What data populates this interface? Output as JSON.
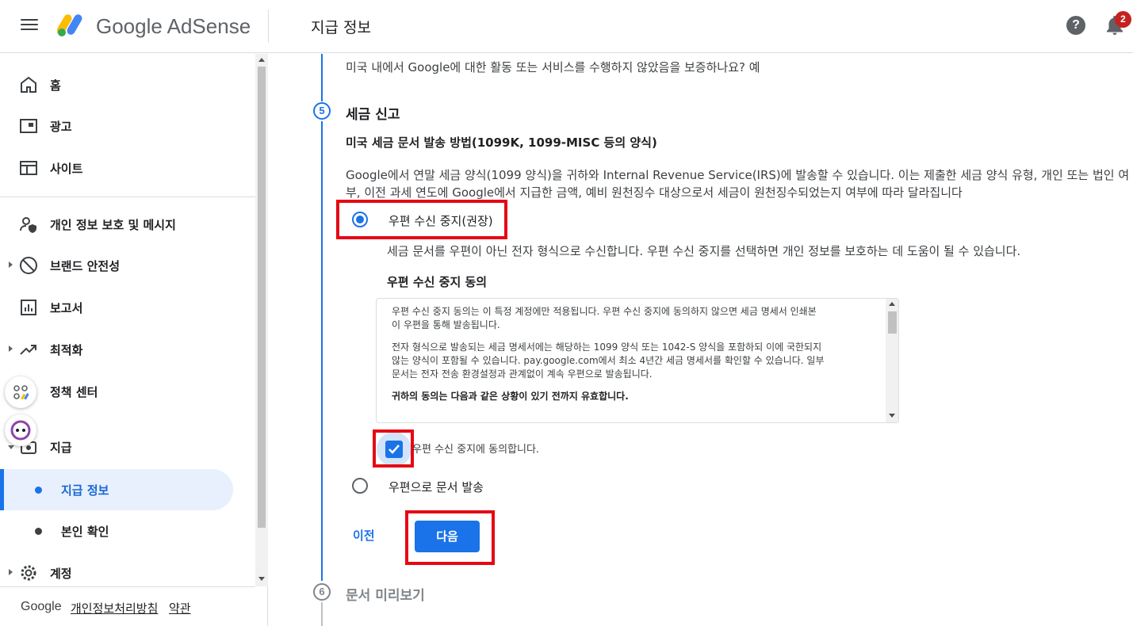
{
  "header": {
    "brand": "Google AdSense",
    "page_title": "지급 정보",
    "notification_count": "2",
    "help_symbol": "?"
  },
  "sidebar": {
    "items": [
      {
        "label": "홈",
        "icon": "home-icon"
      },
      {
        "label": "광고",
        "icon": "ads-icon"
      },
      {
        "label": "사이트",
        "icon": "sites-icon"
      },
      {
        "label": "개인 정보 보호 및 메시지",
        "icon": "privacy-icon"
      },
      {
        "label": "브랜드 안전성",
        "icon": "block-icon"
      },
      {
        "label": "보고서",
        "icon": "reports-icon"
      },
      {
        "label": "최적화",
        "icon": "optimization-icon"
      },
      {
        "label": "정책 센터",
        "icon": "policy-icon"
      },
      {
        "label": "지급",
        "icon": "payments-icon"
      }
    ],
    "sub_items": [
      {
        "label": "지급 정보",
        "active": true
      },
      {
        "label": "본인 확인",
        "active": false
      }
    ],
    "account": {
      "label": "계정",
      "icon": "gear-icon"
    },
    "footer": {
      "google": "Google",
      "privacy": "개인정보처리방침",
      "terms": "약관"
    }
  },
  "main": {
    "prev_answer": "미국 내에서 Google에 대한 활동 또는 서비스를 수행하지 않았음을 보증하나요? 예",
    "step5": {
      "number": "5",
      "title": "세금 신고"
    },
    "section_heading": "미국 세금 문서 발송 방법(1099K, 1099-MISC 등의 양식)",
    "description_line1": "Google에서 연말 세금 양식(1099 양식)을 귀하와 Internal Revenue Service(IRS)에 발송할 수 있습니다. 이는 제출한 세금 양식 유형, 개인 또는 법인 여",
    "description_line2": "부, 이전 과세 연도에 Google에서 지급한 금액, 예비 원천징수 대상으로서 세금이 원천징수되었는지 여부에 따라 달라집니다",
    "option1": {
      "label": "우편 수신 중지(권장)",
      "selected": true,
      "description": "세금 문서를 우편이 아닌 전자 형식으로 수신합니다. 우편 수신 중지를 선택하면 개인 정보를 보호하는 데 도움이 될 수 있습니다."
    },
    "agreement": {
      "heading": "우편 수신 중지 동의",
      "para1_line1": "우편 수신 중지 동의는 이 특정 계정에만 적용됩니다.  우편 수신 중지에 동의하지 않으면 세금 명세서 인쇄본",
      "para1_line2": "이 우편을 통해 발송됩니다.",
      "para2_line1": "전자 형식으로 발송되는 세금 명세서에는 해당하는 1099 양식 또는 1042-S 양식을 포함하되 이에 국한되지",
      "para2_line2": "않는 양식이 포함될 수 있습니다. pay.google.com에서 최소 4년간 세금 명세서를 확인할 수 있습니다. 일부",
      "para2_line3": "문서는 전자 전송 환경설정과 관계없이 계속 우편으로 발송됩니다.",
      "para3": "귀하의 동의는 다음과 같은 상황이 있기 전까지 유효합니다.",
      "checkbox_label": "우편 수신 중지에 동의합니다.",
      "checked": true
    },
    "option2": {
      "label": "우편으로 문서 발송",
      "selected": false
    },
    "buttons": {
      "prev": "이전",
      "next": "다음"
    },
    "step6": {
      "number": "6",
      "title": "문서 미리보기"
    }
  },
  "colors": {
    "accent": "#1a73e8",
    "highlight_border": "#e50914",
    "badge": "#c5221f"
  }
}
